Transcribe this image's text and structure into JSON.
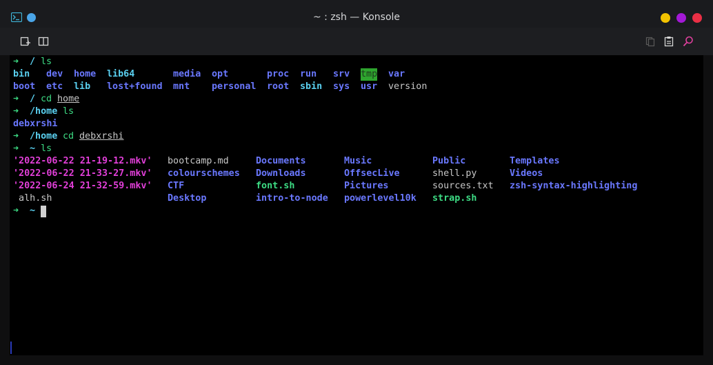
{
  "window": {
    "title": "~ : zsh — Konsole",
    "colors": {
      "minimize": "#f2c200",
      "maximize": "#a319d6",
      "close": "#ea2f45",
      "app_dot": "#4aa5e8"
    }
  },
  "toolbar": {
    "left_icons": [
      "new-tab-icon",
      "split-view-icon"
    ],
    "right_icons": [
      "copy-icon",
      "paste-icon",
      "find-icon"
    ]
  },
  "terminal": {
    "prompt_arrow": "➜",
    "line1": {
      "dir": "/",
      "cmd": "ls"
    },
    "root_listing": [
      [
        "bin",
        "dev",
        "home",
        "lib64",
        "media",
        "opt",
        "proc",
        "run",
        "srv",
        "tmp",
        "var"
      ],
      [
        "boot",
        "etc",
        "lib",
        "lost+found",
        "mnt",
        "personal",
        "root",
        "sbin",
        "sys",
        "usr",
        "version"
      ]
    ],
    "line2": {
      "dir": "/",
      "cmd": "cd",
      "arg": "home"
    },
    "line3": {
      "dir": "/home",
      "cmd": "ls"
    },
    "home_listing": "debxrshi",
    "line4": {
      "dir": "/home",
      "cmd": "cd",
      "arg": "debxrshi"
    },
    "line5": {
      "dir": "~",
      "cmd": "ls"
    },
    "user_listing": {
      "col1": [
        "'2022-06-22 21-19-12.mkv'",
        "'2022-06-22 21-33-27.mkv'",
        "'2022-06-24 21-32-59.mkv'",
        " alh.sh"
      ],
      "col2": [
        "bootcamp.md",
        "colourschemes",
        "CTF",
        "Desktop"
      ],
      "col3": [
        "Documents",
        "Downloads",
        "font.sh",
        "intro-to-node"
      ],
      "col4": [
        "Music",
        "OffsecLive",
        "Pictures",
        "powerlevel10k"
      ],
      "col5": [
        "Public",
        "shell.py",
        "sources.txt",
        "strap.sh"
      ],
      "col6": [
        "Templates",
        "Videos",
        "zsh-syntax-highlighting",
        ""
      ]
    },
    "line6": {
      "dir": "~"
    }
  }
}
